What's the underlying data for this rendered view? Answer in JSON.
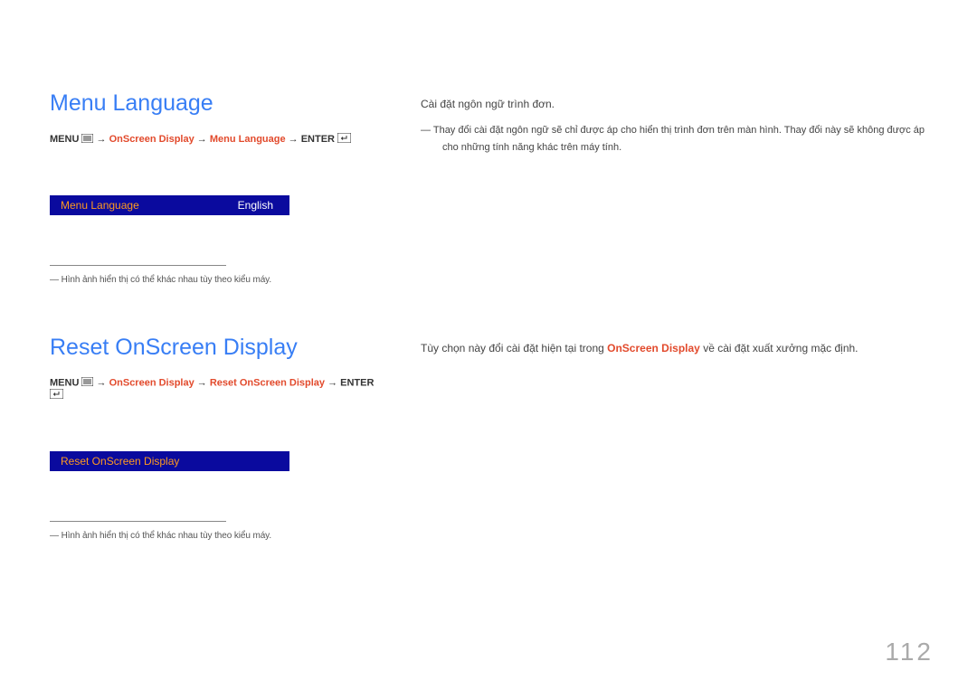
{
  "section1": {
    "heading": "Menu Language",
    "breadcrumb": {
      "menu": "MENU",
      "arrow": "→",
      "osd": "OnScreen Display",
      "item": "Menu Language",
      "enter": "ENTER"
    },
    "osd_bar": {
      "label": "Menu Language",
      "value": "English"
    },
    "footnote": "―  Hình ảnh hiển thị có thể khác nhau tùy theo kiểu máy.",
    "right": {
      "desc": "Cài đặt ngôn ngữ trình đơn.",
      "note": "―  Thay đổi cài đặt ngôn ngữ sẽ chỉ được áp cho hiển thị trình đơn trên màn hình. Thay đổi này sẽ không được áp cho những tính năng khác trên máy tính."
    }
  },
  "section2": {
    "heading": "Reset OnScreen Display",
    "breadcrumb": {
      "menu": "MENU",
      "arrow": "→",
      "osd": "OnScreen Display",
      "item": "Reset OnScreen Display",
      "enter": "ENTER"
    },
    "osd_bar": {
      "label": "Reset OnScreen Display",
      "value": ""
    },
    "footnote": "―  Hình ảnh hiển thị có thể khác nhau tùy theo kiểu máy.",
    "right": {
      "desc_pre": "Tùy chọn này đổi cài đặt hiện tại trong ",
      "desc_osd": "OnScreen Display",
      "desc_post": " về cài đặt xuất xưởng mặc định."
    }
  },
  "page_number": "112"
}
